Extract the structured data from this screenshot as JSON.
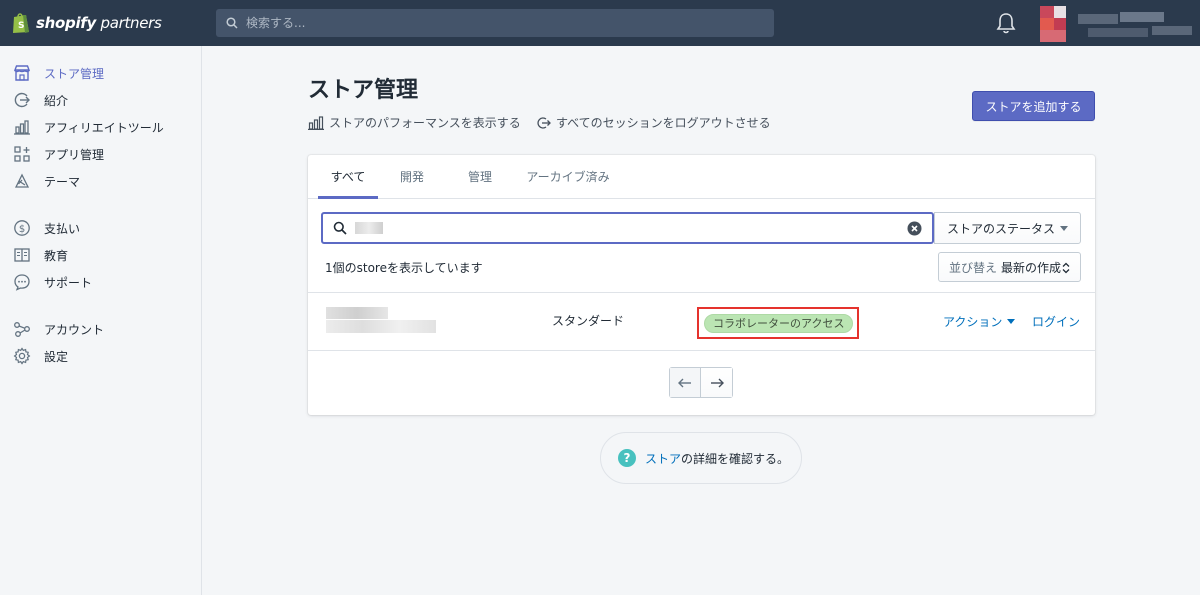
{
  "brand": {
    "name_bold": "shopify",
    "name_light": "partners"
  },
  "topbar": {
    "search_placeholder": "検索する..."
  },
  "sidebar": {
    "items": [
      {
        "label": "ストア管理",
        "icon": "store-icon",
        "active": true
      },
      {
        "label": "紹介",
        "icon": "referral-icon"
      },
      {
        "label": "アフィリエイトツール",
        "icon": "chart-bars-icon"
      },
      {
        "label": "アプリ管理",
        "icon": "apps-icon"
      },
      {
        "label": "テーマ",
        "icon": "theme-icon"
      },
      {
        "label": "支払い",
        "icon": "dollar-icon"
      },
      {
        "label": "教育",
        "icon": "book-icon"
      },
      {
        "label": "サポート",
        "icon": "chat-icon"
      },
      {
        "label": "アカウント",
        "icon": "account-icon"
      },
      {
        "label": "設定",
        "icon": "gear-icon"
      }
    ]
  },
  "main": {
    "title": "ストア管理",
    "performance_link": "ストアのパフォーマンスを表示する",
    "logout_link": "すべてのセッションをログアウトさせる",
    "add_button": "ストアを追加する",
    "tabs": [
      {
        "label": "すべて",
        "active": true
      },
      {
        "label": "開発"
      },
      {
        "label": "管理"
      },
      {
        "label": "アーカイブ済み"
      }
    ],
    "status_filter": "ストアのステータス",
    "result_count": "1個のstoreを表示しています",
    "sort": {
      "label": "並び替え",
      "value": "最新の作成"
    },
    "stores": [
      {
        "plan": "スタンダード",
        "badge": "コラボレーターのアクセス",
        "action": "アクション",
        "login": "ログイン"
      }
    ],
    "help": {
      "link": "ストア",
      "text": "の詳細を確認する。"
    }
  },
  "colors": {
    "accent": "#5c6ac4",
    "topbar": "#2b3a4d",
    "link": "#006fbb",
    "badge": "#bbe5b3",
    "highlight": "#e5322d"
  }
}
